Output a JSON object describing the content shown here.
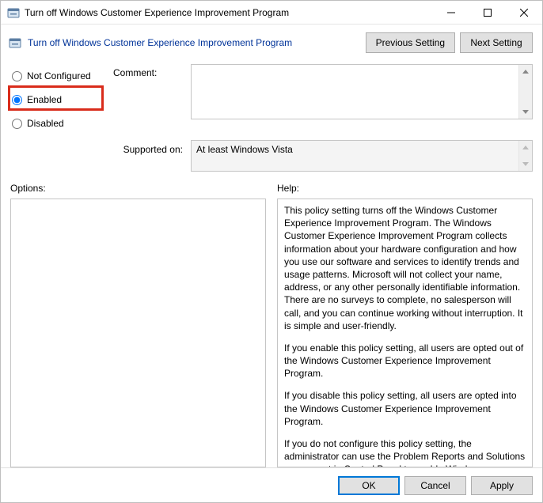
{
  "window": {
    "title": "Turn off Windows Customer Experience Improvement Program"
  },
  "subheader": {
    "title": "Turn off Windows Customer Experience Improvement Program",
    "prev": "Previous Setting",
    "next": "Next Setting"
  },
  "radios": {
    "not_configured": "Not Configured",
    "enabled": "Enabled",
    "disabled": "Disabled",
    "selected": "enabled"
  },
  "comment": {
    "label": "Comment:",
    "value": ""
  },
  "supported": {
    "label": "Supported on:",
    "value": "At least Windows Vista"
  },
  "panels": {
    "options_label": "Options:",
    "help_label": "Help:",
    "options_text": "",
    "help_p1": "This policy setting turns off the Windows Customer Experience Improvement Program. The Windows Customer Experience Improvement Program collects information about your hardware configuration and how you use our software and services to identify trends and usage patterns. Microsoft will not collect your name, address, or any other personally identifiable information. There are no surveys to complete, no salesperson will call, and you can continue working without interruption. It is simple and user-friendly.",
    "help_p2": "If you enable this policy setting, all users are opted out of the Windows Customer Experience Improvement Program.",
    "help_p3": "If you disable this policy setting, all users are opted into the Windows Customer Experience Improvement Program.",
    "help_p4": "If you do not configure this policy setting, the administrator can use the Problem Reports and Solutions component in Control Panel to enable Windows Customer Experience Improvement Program for all users."
  },
  "footer": {
    "ok": "OK",
    "cancel": "Cancel",
    "apply": "Apply"
  }
}
